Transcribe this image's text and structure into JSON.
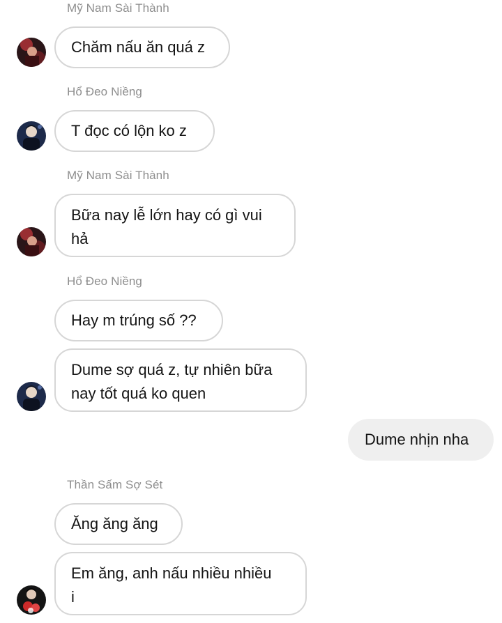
{
  "thread": {
    "sender_names": {
      "s1": "Mỹ Nam Sài Thành",
      "s2": "Hổ Đeo Niềng",
      "s3": "Mỹ Nam Sài Thành",
      "s4": "Hổ Đeo Niềng",
      "s5": "Thần Sấm Sợ Sét"
    },
    "messages": {
      "m1": "Chăm nấu ăn quá z",
      "m2": "T đọc có lộn ko z",
      "m3a": "Bữa nay lễ lớn hay có gì vui",
      "m3b": "hả",
      "m4": "Hay m trúng số ??",
      "m5a": "Dume sợ quá z, tự nhiên bữa",
      "m5b": "nay tốt quá ko quen",
      "m6": "Dume nhịn nha",
      "m7": "Ăng ăng ăng",
      "m8a": "Em ăng, anh nấu nhiều nhiều",
      "m8b": "i"
    }
  },
  "colors": {
    "bubble_border": "#d6d6d6",
    "own_bubble_bg": "#efefef",
    "sender_text": "#8e8e8e",
    "message_text": "#141414"
  }
}
